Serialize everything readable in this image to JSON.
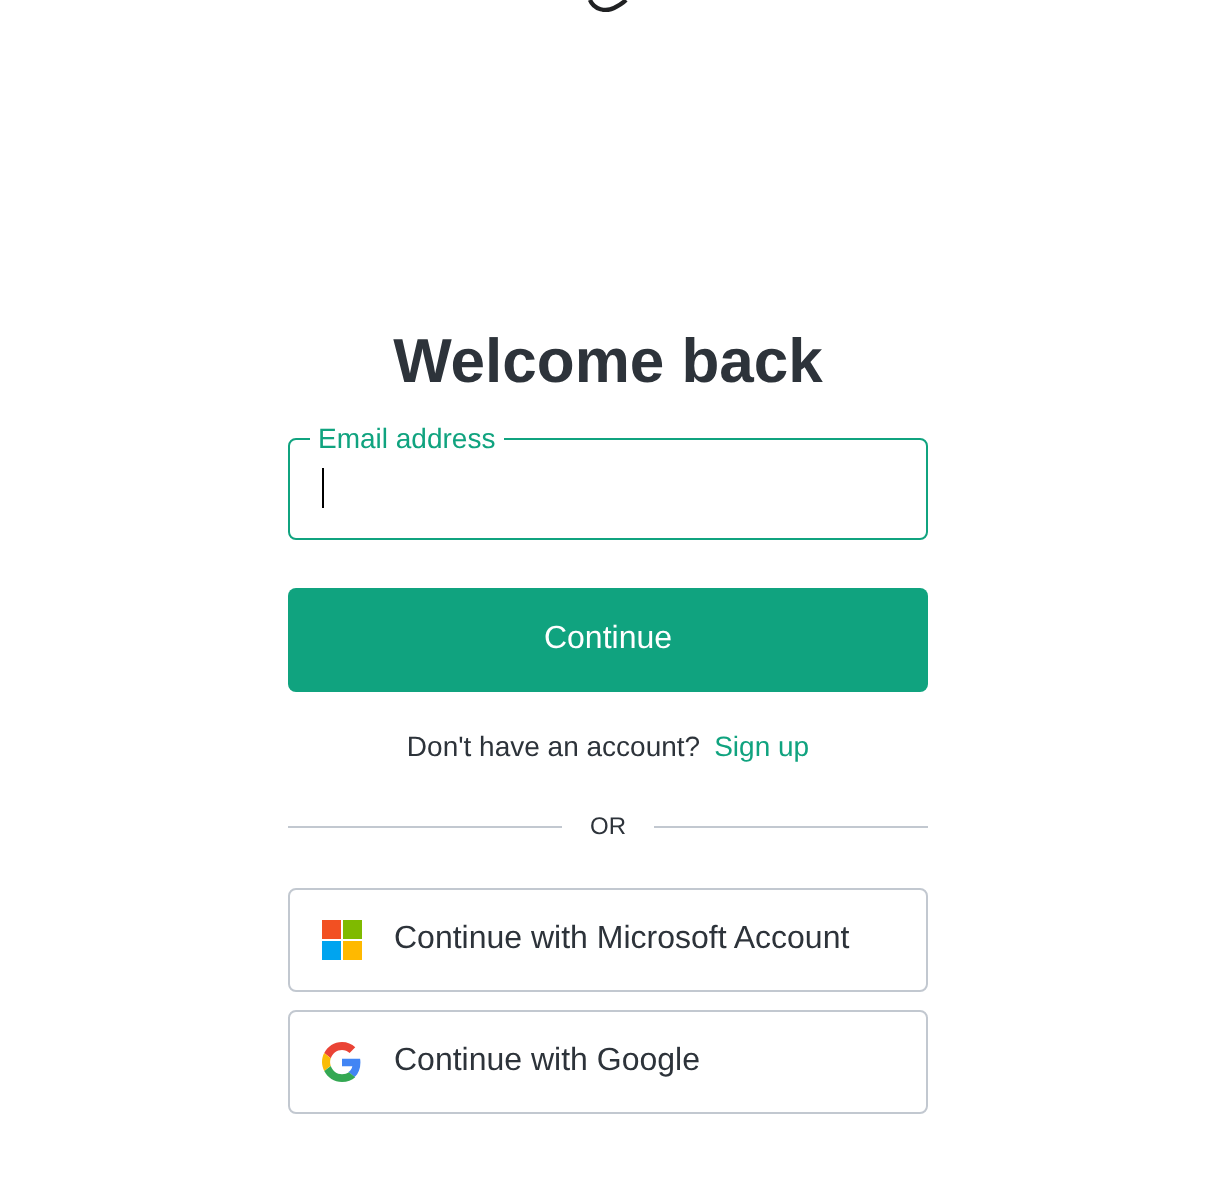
{
  "heading": "Welcome back",
  "email_field": {
    "label": "Email address",
    "focused": true
  },
  "continue_button": "Continue",
  "signup_prompt": {
    "text": "Don't have an account?",
    "link": "Sign up"
  },
  "divider_text": "OR",
  "providers": [
    {
      "kind": "microsoft",
      "label": "Continue with Microsoft Account"
    },
    {
      "kind": "google",
      "label": "Continue with Google"
    }
  ]
}
